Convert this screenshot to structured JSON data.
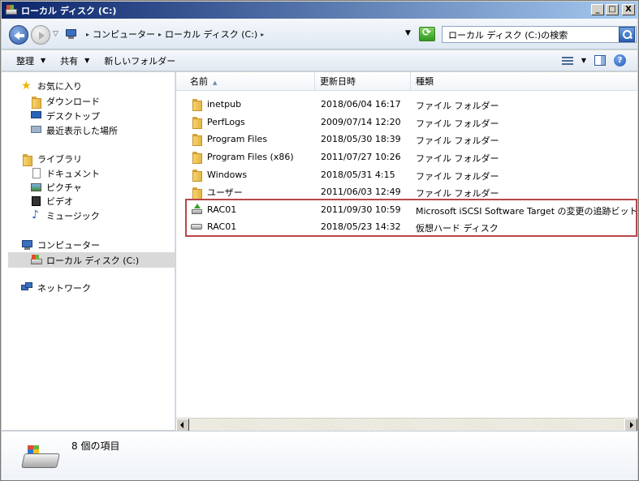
{
  "window": {
    "title": "ローカル ディスク (C:)",
    "controls": [
      "_",
      "□",
      "X"
    ]
  },
  "address": {
    "crumbs": [
      "コンピューター",
      "ローカル ディスク (C:)"
    ],
    "search_placeholder": "ローカル ディスク (C:)の検索"
  },
  "toolbar": {
    "organize": "整理",
    "share": "共有",
    "new_folder": "新しいフォルダー",
    "help": "?"
  },
  "nav": {
    "favorites": "お気に入り",
    "downloads": "ダウンロード",
    "desktop": "デスクトップ",
    "recent": "最近表示した場所",
    "libraries": "ライブラリ",
    "documents": "ドキュメント",
    "pictures": "ピクチャ",
    "videos": "ビデオ",
    "music": "ミュージック",
    "computer": "コンピューター",
    "local_disk": "ローカル ディスク (C:)",
    "network": "ネットワーク"
  },
  "columns": {
    "name": "名前",
    "date": "更新日時",
    "type": "種類"
  },
  "files": [
    {
      "name": "inetpub",
      "date": "2018/06/04 16:17",
      "type": "ファイル フォルダー",
      "icon": "folder-icon"
    },
    {
      "name": "PerfLogs",
      "date": "2009/07/14 12:20",
      "type": "ファイル フォルダー",
      "icon": "folder-icon"
    },
    {
      "name": "Program Files",
      "date": "2018/05/30 18:39",
      "type": "ファイル フォルダー",
      "icon": "folder-icon"
    },
    {
      "name": "Program Files (x86)",
      "date": "2011/07/27 10:26",
      "type": "ファイル フォルダー",
      "icon": "folder-icon"
    },
    {
      "name": "Windows",
      "date": "2018/05/31 4:15",
      "type": "ファイル フォルダー",
      "icon": "folder-icon"
    },
    {
      "name": "ユーザー",
      "date": "2011/06/03 12:49",
      "type": "ファイル フォルダー",
      "icon": "folder-icon"
    },
    {
      "name": "RAC01",
      "date": "2011/09/30 10:59",
      "type": "Microsoft iSCSI Software Target の変更の追跡ビットマップ",
      "icon": "bitmap-icon"
    },
    {
      "name": "RAC01",
      "date": "2018/05/23 14:32",
      "type": "仮想ハード ディスク",
      "icon": "virtual-disk-icon"
    }
  ],
  "details": {
    "item_count": "8 個の項目"
  }
}
